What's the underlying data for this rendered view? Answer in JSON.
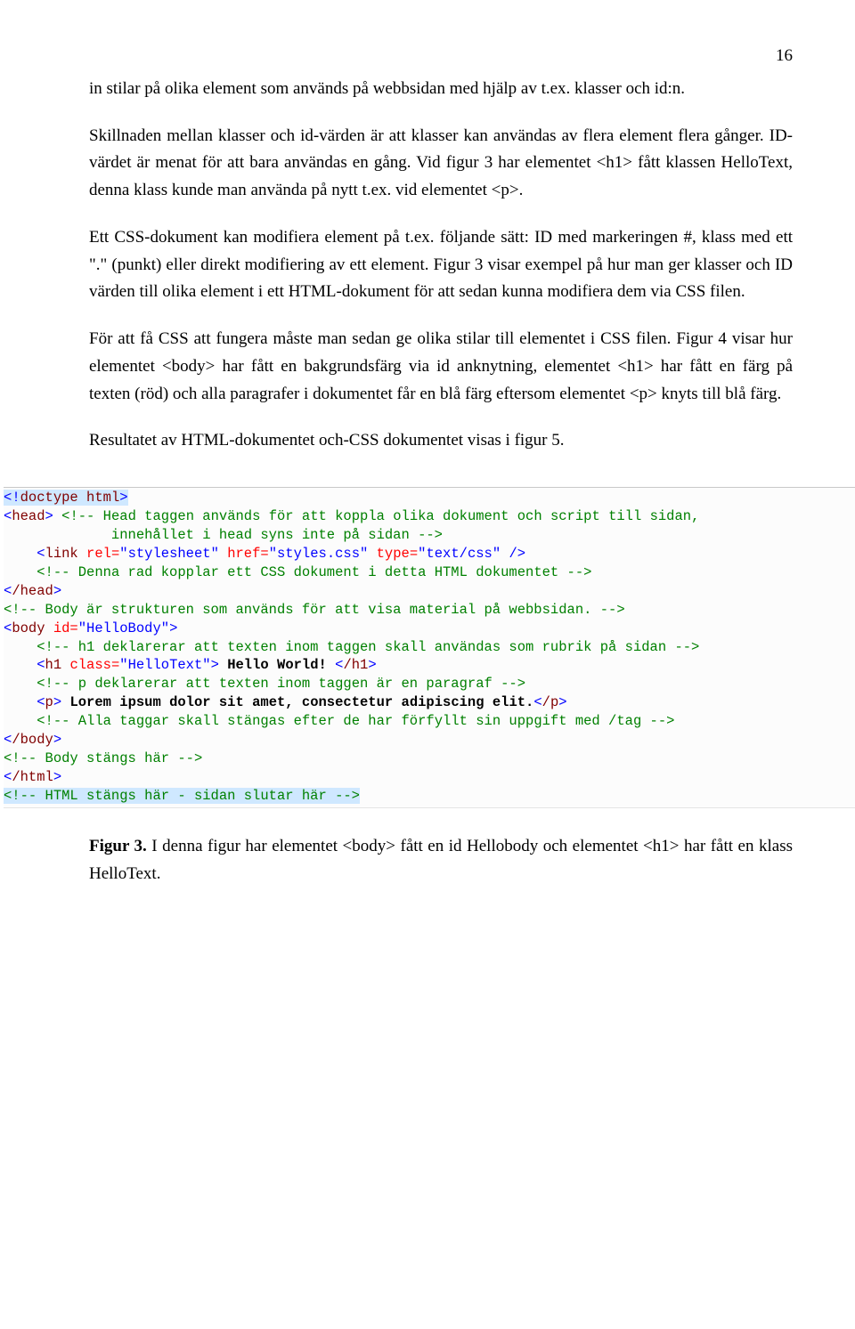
{
  "pagenum": "16",
  "p1": "in stilar på olika element som används på webbsidan med hjälp av t.ex. klasser och id:n.",
  "p2": "Skillnaden mellan klasser och id-värden är att klasser kan användas av flera element flera gånger. ID-värdet är menat för att bara användas en gång. Vid figur 3 har elementet <h1> fått klassen HelloText, denna klass kunde man använda på nytt t.ex. vid elementet <p>.",
  "p3": "Ett CSS-dokument kan modifiera element på t.ex. följande sätt: ID med markeringen #, klass med ett \".\" (punkt) eller direkt modifiering av ett element. Figur 3 visar exempel på hur man ger klasser och ID värden till olika element i ett HTML-dokument för att sedan kunna modifiera dem via CSS filen.",
  "p4": "För att få CSS att fungera måste man sedan ge olika stilar till elementet i CSS filen. Figur 4 visar hur elementet <body> har fått en bakgrundsfärg via id anknytning, elementet <h1> har fått en färg på texten (röd) och alla paragrafer i dokumentet får en blå färg eftersom elementet <p> knyts till blå färg.",
  "p5": "Resultatet av HTML-dokumentet och-CSS dokumentet visas i figur 5.",
  "code": {
    "doctype_lt": "<",
    "doctype_bang": "!",
    "doctype_rest": "doctype",
    "html_word": " html",
    "gt": ">",
    "head_open": "head",
    "cm_head1": " Head taggen används för att koppla olika dokument och script till sidan,",
    "cm_head2": "             innehållet i head syns inte på sidan ",
    "link": "link",
    "rel": " rel=",
    "rel_v": "\"stylesheet\"",
    "href": " href=",
    "href_v": "\"styles.css\"",
    "type": " type=",
    "type_v": "\"text/css\"",
    "cm_link": " Denna rad kopplar ett CSS dokument i detta HTML dokumentet ",
    "head_close": "/head",
    "cm_body": " Body är strukturen som används för att visa material på webbsidan. ",
    "body": "body",
    "id": " id=",
    "id_v": "\"HelloBody\"",
    "cm_h1": " h1 deklarerar att texten inom taggen skall användas som rubrik på sidan ",
    "h1": "h1",
    "class": " class=",
    "class_v": "\"HelloText\"",
    "hello": " Hello World! ",
    "h1_close": "/h1",
    "cm_p": " p deklarerar att texten inom taggen är en paragraf ",
    "p": "p",
    "p_txt": " Lorem ipsum dolor sit amet, consectetur adipiscing elit.",
    "p_close": "/p",
    "cm_tags": " Alla taggar skall stängas efter de har förfyllt sin uppgift med /tag ",
    "body_close": "/body",
    "cm_bodyend": " Body stängs här ",
    "html_close": "/html",
    "cm_htmlend": " HTML stängs här - sidan slutar här "
  },
  "caption_b": "Figur 3.",
  "caption_rest": " I denna figur har elementet <body> fått en id Hellobody och elementet <h1> har fått en klass HelloText."
}
